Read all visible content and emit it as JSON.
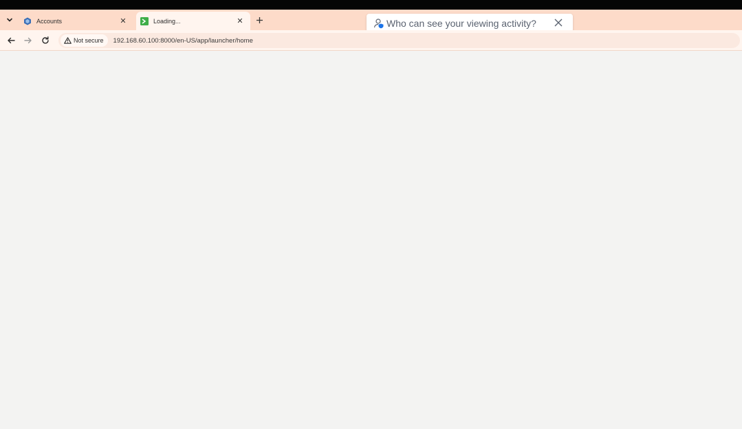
{
  "browser": {
    "tabs": [
      {
        "title": "Accounts",
        "favicon": "app-logo-icon",
        "active": false
      },
      {
        "title": "Loading...",
        "favicon": "terminal-icon",
        "active": true
      }
    ],
    "address_bar": {
      "security_label": "Not secure",
      "url": "192.168.60.100:8000/en-US/app/launcher/home"
    }
  },
  "popup": {
    "text": "Who can see your viewing activity?",
    "icon": "privacy-user-icon"
  },
  "colors": {
    "tabstrip": "#fddbc9",
    "toolbar": "#fff5ef",
    "content": "#f3f3f2",
    "terminal_favicon": "#3fae49",
    "app_favicon": "#3b6fb6"
  }
}
